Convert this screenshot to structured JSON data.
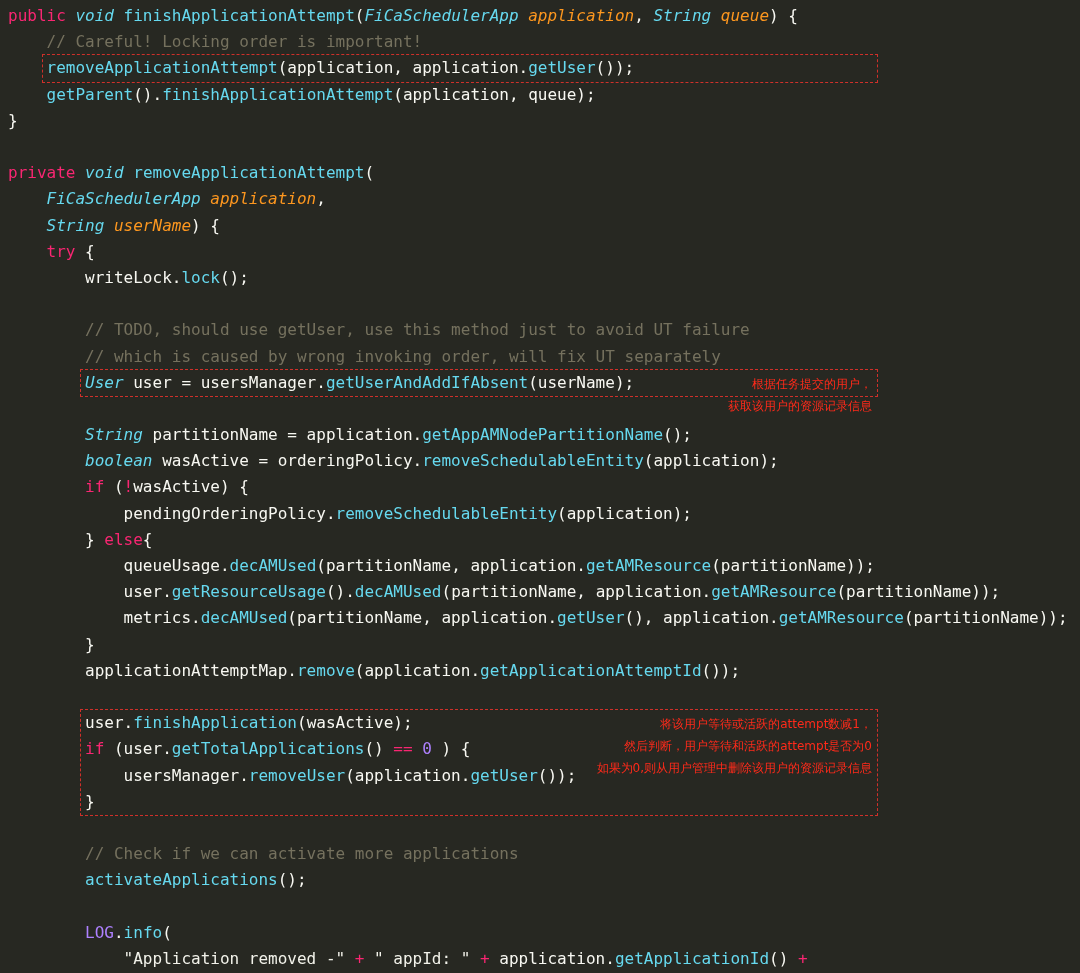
{
  "editor": {
    "lines": [
      {
        "kind": "line",
        "tokens": [
          {
            "text": "public",
            "kind": "keyword"
          },
          {
            "text": " void",
            "kind": "type"
          },
          {
            "text": " finishApplicationAttempt",
            "kind": "function"
          },
          {
            "text": "("
          },
          {
            "text": "FiCaSchedulerApp",
            "kind": "type"
          },
          {
            "text": " application",
            "kind": "parameter"
          },
          {
            "text": ", "
          },
          {
            "text": "String",
            "kind": "type"
          },
          {
            "text": " queue",
            "kind": "parameter"
          },
          {
            "text": ") {"
          }
        ],
        "children": [
          {
            "kind": "line",
            "tokens": [
              {
                "text": "// Careful! Locking order is important!",
                "kind": "comment"
              }
            ]
          },
          {
            "kind": "marked",
            "children": [
              {
                "kind": "line",
                "tokens": [
                  {
                    "text": "removeApplicationAttempt",
                    "kind": "function"
                  },
                  {
                    "text": "(application, application."
                  },
                  {
                    "text": "getUser",
                    "kind": "function"
                  },
                  {
                    "text": "());"
                  }
                ]
              }
            ]
          },
          {
            "kind": "line",
            "tokens": [
              {
                "text": "getParent",
                "kind": "function"
              },
              {
                "text": "()."
              },
              {
                "text": "finishApplicationAttempt",
                "kind": "function"
              },
              {
                "text": "(application, queue);"
              }
            ]
          }
        ]
      },
      {
        "kind": "line",
        "tokens": [
          {
            "text": "}"
          }
        ]
      },
      {
        "kind": "blank"
      },
      {
        "kind": "line",
        "tokens": [
          {
            "text": "private",
            "kind": "keyword"
          },
          {
            "text": " void",
            "kind": "type"
          },
          {
            "text": " removeApplicationAttempt",
            "kind": "function"
          },
          {
            "text": "("
          }
        ],
        "children": [
          {
            "kind": "line",
            "tokens": [
              {
                "text": "FiCaSchedulerApp",
                "kind": "type"
              },
              {
                "text": " application",
                "kind": "parameter"
              },
              {
                "text": ","
              }
            ]
          },
          {
            "kind": "line",
            "tokens": [
              {
                "text": "String",
                "kind": "type"
              },
              {
                "text": " userName",
                "kind": "parameter"
              },
              {
                "text": ") {"
              }
            ]
          },
          {
            "kind": "line",
            "tokens": [
              {
                "text": "try",
                "kind": "keyword"
              },
              {
                "text": " {"
              }
            ],
            "children": [
              {
                "kind": "line",
                "tokens": [
                  {
                    "text": "writeLock."
                  },
                  {
                    "text": "lock",
                    "kind": "function"
                  },
                  {
                    "text": "();"
                  }
                ]
              },
              {
                "kind": "blank"
              },
              {
                "kind": "line",
                "tokens": [
                  {
                    "text": "// TODO, should use getUser, use this method just to avoid UT failure",
                    "kind": "comment"
                  }
                ]
              },
              {
                "kind": "line",
                "tokens": [
                  {
                    "text": "// which is caused by wrong invoking order, will fix UT separately",
                    "kind": "comment"
                  }
                ]
              },
              {
                "kind": "marked",
                "note": [
                  "根据任务提交的用户，",
                  "获取该用户的资源记录信息"
                ],
                "children": [
                  {
                    "kind": "line",
                    "tokens": [
                      {
                        "text": "User",
                        "kind": "type"
                      },
                      {
                        "text": " user = usersManager."
                      },
                      {
                        "text": "getUserAndAddIfAbsent",
                        "kind": "function"
                      },
                      {
                        "text": "(userName);"
                      }
                    ]
                  }
                ]
              },
              {
                "kind": "blank"
              },
              {
                "kind": "line",
                "tokens": [
                  {
                    "text": "String",
                    "kind": "type"
                  },
                  {
                    "text": " partitionName = application."
                  },
                  {
                    "text": "getAppAMNodePartitionName",
                    "kind": "function"
                  },
                  {
                    "text": "();"
                  }
                ]
              },
              {
                "kind": "line",
                "tokens": [
                  {
                    "text": "boolean",
                    "kind": "type"
                  },
                  {
                    "text": " wasActive = orderingPolicy."
                  },
                  {
                    "text": "removeSchedulableEntity",
                    "kind": "function"
                  },
                  {
                    "text": "(application);"
                  }
                ]
              },
              {
                "kind": "line",
                "tokens": [
                  {
                    "text": "if",
                    "kind": "keyword"
                  },
                  {
                    "text": " ("
                  },
                  {
                    "text": "!",
                    "kind": "operator"
                  },
                  {
                    "text": "wasActive) {"
                  }
                ],
                "children": [
                  {
                    "kind": "line",
                    "tokens": [
                      {
                        "text": "pendingOrderingPolicy."
                      },
                      {
                        "text": "removeSchedulableEntity",
                        "kind": "function"
                      },
                      {
                        "text": "(application);"
                      }
                    ]
                  }
                ]
              },
              {
                "kind": "line",
                "tokens": [
                  {
                    "text": "} "
                  },
                  {
                    "text": "else",
                    "kind": "keyword"
                  },
                  {
                    "text": "{"
                  }
                ],
                "children": [
                  {
                    "kind": "line",
                    "tokens": [
                      {
                        "text": "queueUsage."
                      },
                      {
                        "text": "decAMUsed",
                        "kind": "function"
                      },
                      {
                        "text": "(partitionName, application."
                      },
                      {
                        "text": "getAMResource",
                        "kind": "function"
                      },
                      {
                        "text": "(partitionName));"
                      }
                    ]
                  },
                  {
                    "kind": "line",
                    "tokens": [
                      {
                        "text": "user."
                      },
                      {
                        "text": "getResourceUsage",
                        "kind": "function"
                      },
                      {
                        "text": "()."
                      },
                      {
                        "text": "decAMUsed",
                        "kind": "function"
                      },
                      {
                        "text": "(partitionName, application."
                      },
                      {
                        "text": "getAMResource",
                        "kind": "function"
                      },
                      {
                        "text": "(partitionName));"
                      }
                    ]
                  },
                  {
                    "kind": "line",
                    "tokens": [
                      {
                        "text": "metrics."
                      },
                      {
                        "text": "decAMUsed",
                        "kind": "function"
                      },
                      {
                        "text": "(partitionName, application."
                      },
                      {
                        "text": "getUser",
                        "kind": "function"
                      },
                      {
                        "text": "(), application."
                      },
                      {
                        "text": "getAMResource",
                        "kind": "function"
                      },
                      {
                        "text": "(partitionName));"
                      }
                    ]
                  }
                ]
              },
              {
                "kind": "line",
                "tokens": [
                  {
                    "text": "}"
                  }
                ]
              },
              {
                "kind": "line",
                "tokens": [
                  {
                    "text": "applicationAttemptMap."
                  },
                  {
                    "text": "remove",
                    "kind": "function"
                  },
                  {
                    "text": "(application."
                  },
                  {
                    "text": "getApplicationAttemptId",
                    "kind": "function"
                  },
                  {
                    "text": "());"
                  }
                ]
              },
              {
                "kind": "blank"
              },
              {
                "kind": "marked",
                "note": [
                  "将该用户等待或活跃的attempt数减1，",
                  "然后判断，用户等待和活跃的attempt是否为0",
                  "如果为0,则从用户管理中删除该用户的资源记录信息"
                ],
                "children": [
                  {
                    "kind": "line",
                    "tokens": [
                      {
                        "text": "user."
                      },
                      {
                        "text": "finishApplication",
                        "kind": "function"
                      },
                      {
                        "text": "(wasActive);"
                      }
                    ]
                  },
                  {
                    "kind": "line",
                    "tokens": [
                      {
                        "text": "if",
                        "kind": "keyword"
                      },
                      {
                        "text": " (user."
                      },
                      {
                        "text": "getTotalApplications",
                        "kind": "function"
                      },
                      {
                        "text": "() "
                      },
                      {
                        "text": "==",
                        "kind": "operator"
                      },
                      {
                        "text": " 0",
                        "kind": "number"
                      },
                      {
                        "text": " ) {"
                      }
                    ],
                    "children": [
                      {
                        "kind": "line",
                        "tokens": [
                          {
                            "text": "usersManager."
                          },
                          {
                            "text": "removeUser",
                            "kind": "function"
                          },
                          {
                            "text": "(application."
                          },
                          {
                            "text": "getUser",
                            "kind": "function"
                          },
                          {
                            "text": "());"
                          }
                        ]
                      }
                    ]
                  },
                  {
                    "kind": "line",
                    "tokens": [
                      {
                        "text": "}"
                      }
                    ]
                  }
                ]
              },
              {
                "kind": "blank"
              },
              {
                "kind": "line",
                "tokens": [
                  {
                    "text": "// Check if we can activate more applications",
                    "kind": "comment"
                  }
                ]
              },
              {
                "kind": "line",
                "tokens": [
                  {
                    "text": "activateApplications",
                    "kind": "function"
                  },
                  {
                    "text": "();"
                  }
                ]
              },
              {
                "kind": "blank"
              },
              {
                "kind": "line",
                "tokens": [
                  {
                    "text": "LOG",
                    "kind": "constant"
                  },
                  {
                    "text": "."
                  },
                  {
                    "text": "info",
                    "kind": "function"
                  },
                  {
                    "text": "("
                  }
                ],
                "children": [
                  {
                    "kind": "line",
                    "tokens": [
                      {
                        "text": "\"Application removed -\"",
                        "kind": "string"
                      },
                      {
                        "text": " +",
                        "kind": "operator"
                      },
                      {
                        "text": " \" appId: \"",
                        "kind": "string"
                      },
                      {
                        "text": " +",
                        "kind": "operator"
                      },
                      {
                        "text": " application."
                      },
                      {
                        "text": "getApplicationId",
                        "kind": "function"
                      },
                      {
                        "text": "()"
                      },
                      {
                        "text": " +",
                        "kind": "operator"
                      }
                    ]
                  }
                ]
              }
            ]
          }
        ]
      }
    ]
  }
}
